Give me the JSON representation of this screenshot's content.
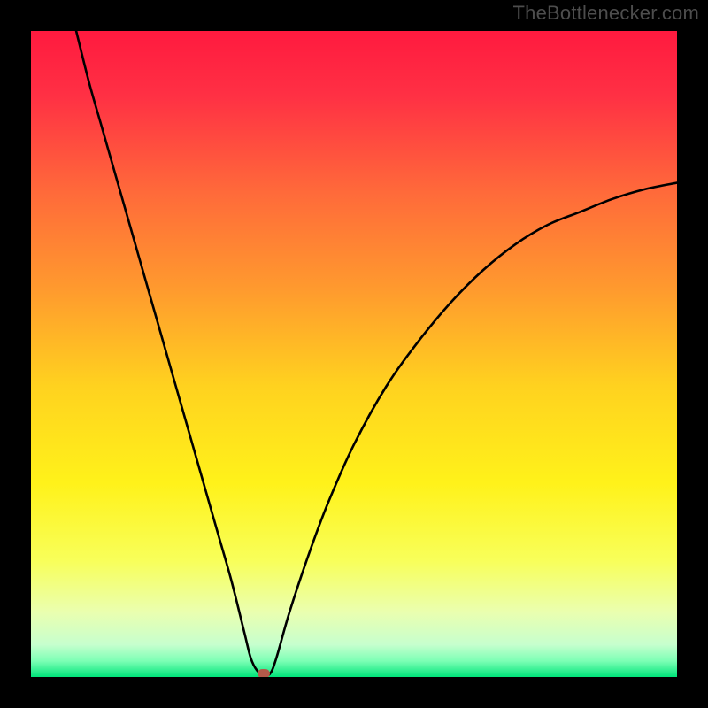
{
  "watermark": {
    "text": "TheBottlenecker.com"
  },
  "chart_data": {
    "type": "line",
    "title": "",
    "xlabel": "",
    "ylabel": "",
    "xlim": [
      0,
      100
    ],
    "ylim": [
      0,
      100
    ],
    "grid": false,
    "legend": false,
    "background_gradient_stops": [
      {
        "pos": 0.0,
        "color": "#ff1a3f"
      },
      {
        "pos": 0.1,
        "color": "#ff3044"
      },
      {
        "pos": 0.25,
        "color": "#ff6a3a"
      },
      {
        "pos": 0.4,
        "color": "#ff9a2e"
      },
      {
        "pos": 0.55,
        "color": "#ffd21f"
      },
      {
        "pos": 0.7,
        "color": "#fff21a"
      },
      {
        "pos": 0.82,
        "color": "#f8ff5a"
      },
      {
        "pos": 0.9,
        "color": "#eaffb0"
      },
      {
        "pos": 0.95,
        "color": "#c6ffce"
      },
      {
        "pos": 0.975,
        "color": "#7dffb5"
      },
      {
        "pos": 1.0,
        "color": "#00e57a"
      }
    ],
    "series": [
      {
        "name": "bottleneck-curve",
        "x": [
          7,
          9,
          11,
          13,
          15,
          17,
          19,
          21,
          23,
          25,
          27,
          29,
          31,
          33,
          34,
          35,
          36,
          37,
          38,
          40,
          43,
          46,
          50,
          55,
          60,
          65,
          70,
          75,
          80,
          85,
          90,
          95,
          100
        ],
        "values": [
          100,
          92,
          85,
          78,
          71,
          64,
          57,
          50,
          43,
          36,
          29,
          22,
          15,
          7,
          3,
          1,
          0.5,
          0.5,
          3,
          10,
          19,
          27,
          36,
          45,
          52,
          58,
          63,
          67,
          70,
          72,
          74,
          75.5,
          76.5
        ]
      }
    ],
    "marker_point": {
      "x": 36,
      "y": 0.5,
      "color": "#b35a4a"
    }
  }
}
